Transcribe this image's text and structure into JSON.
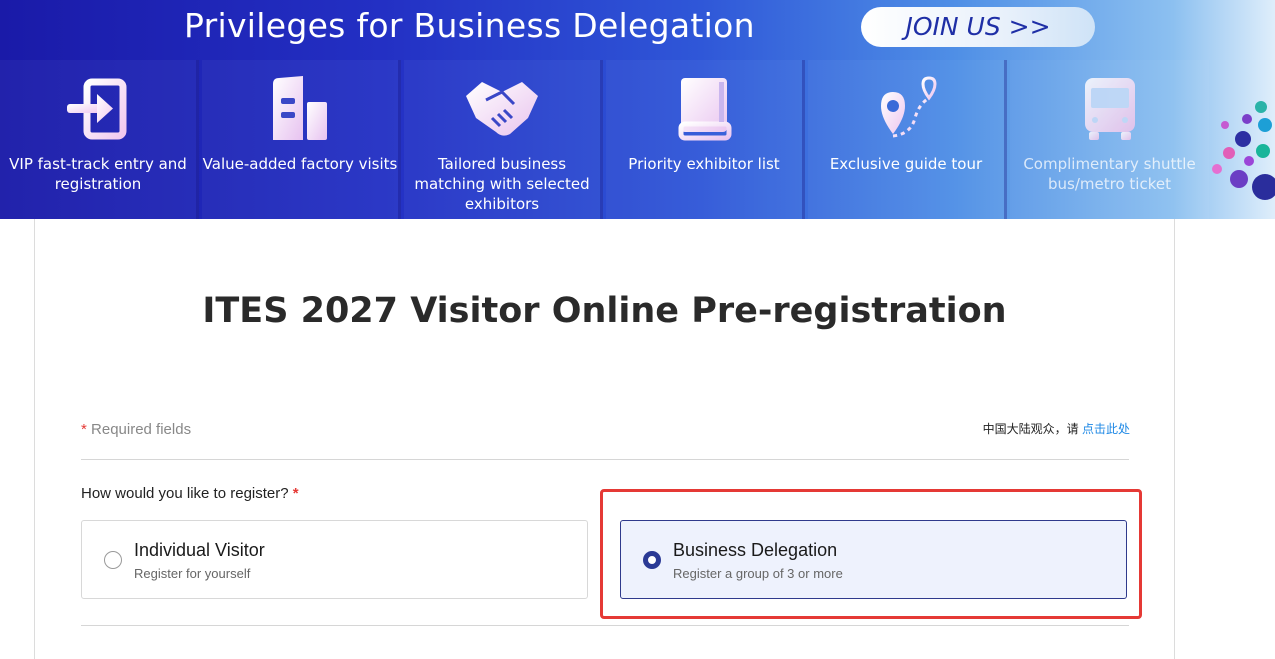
{
  "banner": {
    "title": "Privileges for Business Delegation",
    "join_label": "JOIN US  >>",
    "benefits": [
      {
        "label": "VIP fast-track entry and registration",
        "icon": "entry-icon"
      },
      {
        "label": "Value-added factory visits",
        "icon": "building-icon"
      },
      {
        "label": "Tailored business matching with selected exhibitors",
        "icon": "handshake-icon"
      },
      {
        "label": "Priority exhibitor list",
        "icon": "book-icon"
      },
      {
        "label": "Exclusive guide tour",
        "icon": "map-pin-route-icon"
      },
      {
        "label": "Complimentary shuttle bus/metro ticket",
        "icon": "bus-icon"
      }
    ]
  },
  "form": {
    "title": "ITES 2027 Visitor Online Pre-registration",
    "required_star": "*",
    "required_text": "Required fields",
    "cn_prefix": "中国大陆观众，请",
    "cn_link": "点击此处",
    "question": "How would you like to register?",
    "question_star": "*",
    "options": [
      {
        "title": "Individual Visitor",
        "subtitle": "Register for yourself",
        "selected": false
      },
      {
        "title": "Business Delegation",
        "subtitle": "Register a group of 3 or more",
        "selected": true
      }
    ]
  },
  "colors": {
    "banner_blue": "#1a1aa8",
    "accent_navy": "#2b3a95",
    "highlight_red": "#e53935",
    "link_blue": "#1e88e5"
  }
}
